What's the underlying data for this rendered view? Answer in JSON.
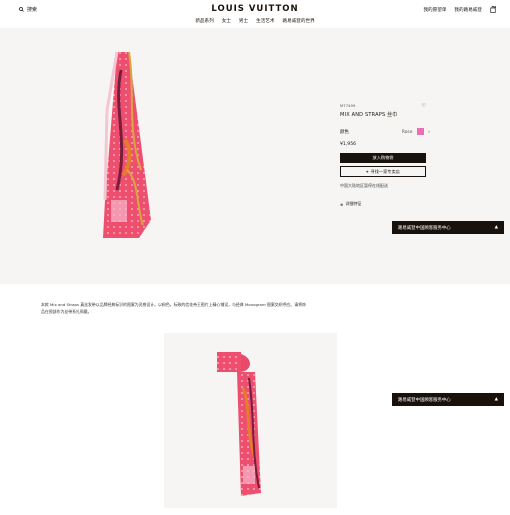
{
  "header": {
    "search_label": "搜索",
    "logo": "LOUIS VUITTON",
    "nav": [
      "新品系列",
      "女士",
      "男士",
      "生活艺术",
      "路易威登的世界"
    ],
    "wishlist": "我的愿望单",
    "account": "我的路易威登"
  },
  "product": {
    "sku": "M77499",
    "title": "MIX AND STRAPS 丝巾",
    "color_label": "颜色",
    "color_value": "Rose",
    "price": "¥1,956",
    "add_to_cart": "放入购物袋",
    "find_in_store": "寻找一家专卖店",
    "delivery_note": "中国大陆地区暂停在线配送",
    "details_label": "详细特征",
    "colors": {
      "swatch": "#ec6fb2",
      "scarf_base": "#ee4f6f"
    }
  },
  "chat": {
    "label": "路易威登中国顾客服务中心",
    "chevron": "▲"
  },
  "description": {
    "text": "本款 Mix and Straps 真丝发带以品牌经典标识的图案为灵感设计。以粉色，标致的信花帝王图片上精心铺设，与经典 Monogram 图案交织呼应。请将饰品在颈部作为丝带系扎佩戴。"
  }
}
